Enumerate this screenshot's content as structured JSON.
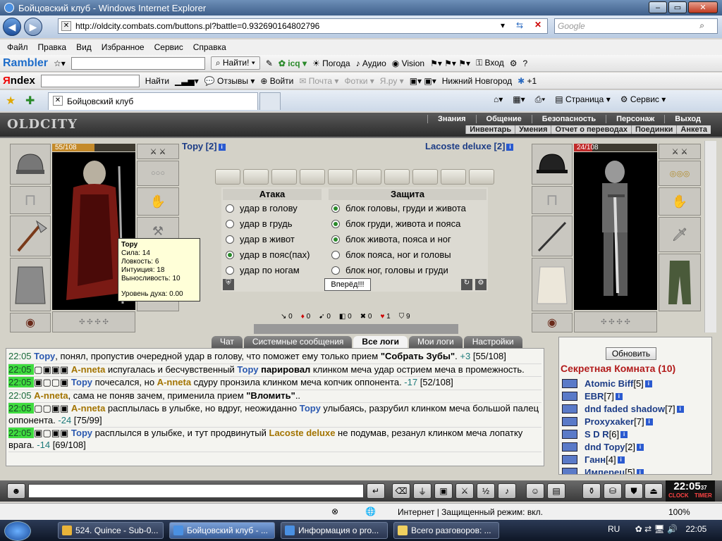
{
  "window": {
    "title": "Бойцовский клуб - Windows Internet Explorer"
  },
  "address": {
    "url": "http://oldcity.combats.com/buttons.pl?battle=0.932690164802796",
    "search_placeholder": "Google"
  },
  "menu": [
    "Файл",
    "Правка",
    "Вид",
    "Избранное",
    "Сервис",
    "Справка"
  ],
  "rambler_bar": {
    "logo": "Rambler",
    "find": "Найти!",
    "icq": "icq",
    "weather": "Погода",
    "audio": "Аудио",
    "vision": "Vision",
    "login": "Вход"
  },
  "yandex_bar": {
    "logo_a": "Я",
    "logo_b": "ndex",
    "find": "Найти",
    "reviews": "Отзывы",
    "signin": "Войти",
    "mail": "Почта",
    "photos": "Фотки",
    "yaru": "Я.ру",
    "city": "Нижний Новгород",
    "plus": "+1"
  },
  "tabs": {
    "active": "Бойцовский клуб",
    "page": "Страница",
    "service": "Сервис"
  },
  "game": {
    "logo": "OLDCITY",
    "topnav": [
      "Знания",
      "Общение",
      "Безопасность",
      "Персонаж",
      "Выход"
    ],
    "subnav": [
      "Инвентарь",
      "Умения",
      "Отчет о переводах",
      "Поединки",
      "Анкета"
    ],
    "left_player": {
      "name": "Тору [2]",
      "hp": "55/108",
      "hp_fraction": 0.51
    },
    "right_player": {
      "name": "Lacoste deluxe [2]",
      "hp": "24/108",
      "hp_fraction": 0.22
    },
    "tooltip": {
      "name": "Тору",
      "str": "Сила: 14",
      "agi": "Ловкость: 6",
      "int": "Интуиция: 18",
      "end": "Выносливость: 10",
      "spirit": "Уровень духа: 0.00"
    },
    "attack": {
      "title": "Атака",
      "options": [
        "удар в голову",
        "удар в грудь",
        "удар в живот",
        "удар в пояс(пах)",
        "удар по ногам"
      ],
      "selected": 3
    },
    "defense": {
      "title": "Защита",
      "options": [
        "блок головы, груди и живота",
        "блок груди, живота и пояса",
        "блок живота, пояса и ног",
        "блок пояса, ног и головы",
        "блок ног, головы и груди"
      ],
      "selected": 2
    },
    "go_button": "Вперёд!!!",
    "stats": [
      "0",
      "0",
      "0",
      "0",
      "0",
      "1",
      "9"
    ],
    "chat_tabs": [
      "Чат",
      "Системные сообщения",
      "Все логи",
      "Мои логи",
      "Настройки"
    ],
    "log": [
      {
        "time": "22:05",
        "hl": false,
        "parts": [
          {
            "c": "p-tory",
            "t": "Тору"
          },
          {
            "c": "",
            "t": ", понял, пропустив очередной удар в голову, что поможет ему только прием "
          },
          {
            "c": "b",
            "t": "\"Собрать Зубы\""
          },
          {
            "c": "",
            "t": ". "
          },
          {
            "c": "dmg",
            "t": "+3"
          },
          {
            "c": "",
            "t": " [55/108]"
          }
        ]
      },
      {
        "time": "22:05",
        "hl": true,
        "parts": [
          {
            "c": "",
            "t": "▢▣▣▣ "
          },
          {
            "c": "p-anneta",
            "t": "A-nneta"
          },
          {
            "c": "",
            "t": " испугалась и бесчувственный "
          },
          {
            "c": "p-tory",
            "t": "Тору"
          },
          {
            "c": "b",
            "t": " парировал"
          },
          {
            "c": "",
            "t": " клинком меча удар острием меча в промежность."
          }
        ]
      },
      {
        "time": "22:05",
        "hl": true,
        "parts": [
          {
            "c": "",
            "t": "▣▢▢▣ "
          },
          {
            "c": "p-tory",
            "t": "Тору"
          },
          {
            "c": "",
            "t": " почесался, но "
          },
          {
            "c": "p-anneta",
            "t": "A-nneta"
          },
          {
            "c": "",
            "t": " сдуру пронзила клинком меча копчик оппонента. "
          },
          {
            "c": "dmg",
            "t": "-17"
          },
          {
            "c": "",
            "t": " [52/108]"
          }
        ]
      },
      {
        "time": "22:05",
        "hl": false,
        "parts": [
          {
            "c": "p-anneta",
            "t": "A-nneta"
          },
          {
            "c": "",
            "t": ", сама не поняв зачем, применила прием "
          },
          {
            "c": "b",
            "t": "\"Вломить\""
          },
          {
            "c": "",
            "t": ".."
          }
        ]
      },
      {
        "time": "22:05",
        "hl": true,
        "parts": [
          {
            "c": "",
            "t": "▢▢▣▣ "
          },
          {
            "c": "p-anneta",
            "t": "A-nneta"
          },
          {
            "c": "",
            "t": " расплылась в улыбке, но вдруг, неожиданно "
          },
          {
            "c": "p-tory",
            "t": "Тору"
          },
          {
            "c": "",
            "t": " улыбаясь, разрубил клинком меча большой палец оппонента. "
          },
          {
            "c": "dmg",
            "t": "-24"
          },
          {
            "c": "",
            "t": " [75/99]"
          }
        ]
      },
      {
        "time": "22:05",
        "hl": true,
        "parts": [
          {
            "c": "",
            "t": "▣▢▣▣ "
          },
          {
            "c": "p-tory",
            "t": "Тору"
          },
          {
            "c": "",
            "t": " расплылся в улыбке, и тут продвинутый "
          },
          {
            "c": "p-lac",
            "t": "Lacoste deluxe"
          },
          {
            "c": "",
            "t": " не подумав, резанул клинком меча лопатку врага. "
          },
          {
            "c": "dmg",
            "t": "-14"
          },
          {
            "c": "",
            "t": " [69/108]"
          }
        ]
      }
    ],
    "side": {
      "refresh": "Обновить",
      "room": "Секретная Комната (10)",
      "users": [
        {
          "name": "Atomic Biff",
          "lvl": "[5]"
        },
        {
          "name": "EBR",
          "lvl": "[7]"
        },
        {
          "name": "dnd faded shadow",
          "lvl": "[7]"
        },
        {
          "name": "Proxyxaker",
          "lvl": "[7]"
        },
        {
          "name": "S D R",
          "lvl": "[6]"
        },
        {
          "name": "dnd Тору",
          "lvl": "[2]"
        },
        {
          "name": "Ганн",
          "lvl": "[4]"
        },
        {
          "name": "Имперец",
          "lvl": "[5]"
        }
      ]
    },
    "clock": {
      "time": "22:05",
      "sec": "37",
      "clock_lbl": "CLOCK",
      "timer_lbl": "TIMER"
    }
  },
  "statusbar": {
    "zone": "Интернет | Защищенный режим: вкл.",
    "zoom": "100%"
  },
  "taskbar": {
    "items": [
      "524. Quince - Sub-0...",
      "Бойцовский клуб - ...",
      "Информация о pro...",
      "Всего разговоров: ..."
    ],
    "lang": "RU",
    "time": "22:05"
  }
}
